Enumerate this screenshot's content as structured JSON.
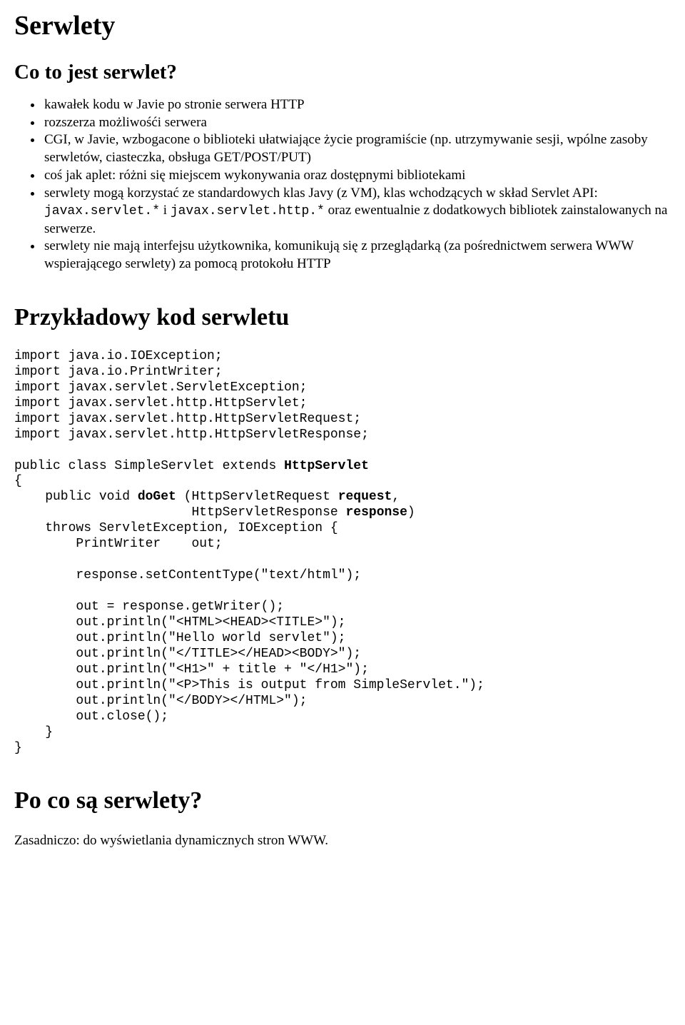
{
  "title": "Serwlety",
  "h2_1": "Co to jest serwlet?",
  "bullets": {
    "b1": "kawałek kodu w Javie po stronie serwera HTTP",
    "b2": "rozszerza możliwośći serwera",
    "b3": "CGI, w Javie, wzbogacone o biblioteki ułatwiające życie programiście (np. utrzymywanie sesji, wpólne zasoby serwletów, ciasteczka, obsługa GET/POST/PUT)",
    "b4": "coś jak aplet: różni się miejscem wykonywania oraz dostępnymi bibliotekami",
    "b5_pre": "serwlety mogą korzystać ze standardowych klas Javy (z VM), klas wchodzących w skład Servlet API: ",
    "b5_code1": "javax.servlet.*",
    "b5_mid": " i ",
    "b5_code2": "javax.servlet.http.*",
    "b5_post": " oraz ewentualnie z dodatkowych bibliotek zainstalowanych na serwerze.",
    "b6": "serwlety nie mają interfejsu użytkownika, komunikują się z przeglądarką (za pośrednictwem serwera WWW wspierającego serwlety) za pomocą protokołu HTTP"
  },
  "h2_2": "Przykładowy kod serwletu",
  "code": {
    "l01": "import java.io.IOException;",
    "l02": "import java.io.PrintWriter;",
    "l03": "import javax.servlet.ServletException;",
    "l04": "import javax.servlet.http.HttpServlet;",
    "l05": "import javax.servlet.http.HttpServletRequest;",
    "l06": "import javax.servlet.http.HttpServletResponse;",
    "l07a": "public class SimpleServlet extends ",
    "l07b": "HttpServlet",
    "l08": "{",
    "l09a": "    public void ",
    "l09b": "doGet",
    "l09c": " (HttpServletRequest ",
    "l09d": "request",
    "l09e": ",",
    "l10a": "                       HttpServletResponse ",
    "l10b": "response",
    "l10c": ")",
    "l11": "    throws ServletException, IOException {",
    "l12": "        PrintWriter    out;",
    "l13": "        response.setContentType(\"text/html\");",
    "l14": "        out = response.getWriter();",
    "l15": "        out.println(\"<HTML><HEAD><TITLE>\");",
    "l16": "        out.println(\"Hello world servlet\");",
    "l17": "        out.println(\"</TITLE></HEAD><BODY>\");",
    "l18": "        out.println(\"<H1>\" + title + \"</H1>\");",
    "l19": "        out.println(\"<P>This is output from SimpleServlet.\");",
    "l20": "        out.println(\"</BODY></HTML>\");",
    "l21": "        out.close();",
    "l22": "    }",
    "l23": "}"
  },
  "h2_3": "Po co są serwlety?",
  "para1": "Zasadniczo: do wyświetlania dynamicznych stron WWW."
}
